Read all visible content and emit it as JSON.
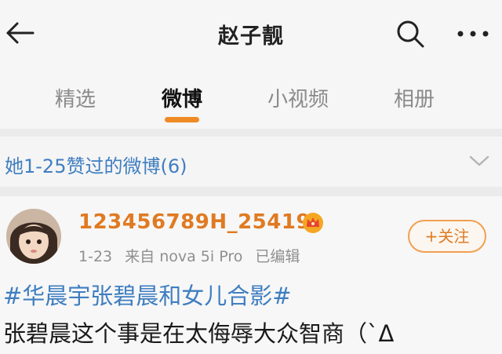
{
  "header": {
    "title": "赵子靓"
  },
  "tabs": [
    {
      "label": "精选",
      "active": false
    },
    {
      "label": "微博",
      "active": true
    },
    {
      "label": "小视频",
      "active": false
    },
    {
      "label": "相册",
      "active": false
    }
  ],
  "liked_summary": {
    "text": "她1-25赞过的微博(6)"
  },
  "post": {
    "username": "123456789H_25419",
    "date": "1-23",
    "source": "来自 nova 5i Pro",
    "edited": "已编辑",
    "follow_label": "+关注",
    "hashtag": "#华晨宇张碧晨和女儿合影#",
    "content": "张碧晨这个事是在太侮辱大众智商（`Δ"
  },
  "colors": {
    "accent_orange": "#f08a24",
    "link_blue": "#3f7ec0",
    "username_orange": "#e07a22"
  },
  "icons": [
    "back-arrow-icon",
    "search-icon",
    "more-dots-icon",
    "chevron-down-icon",
    "vip-crown-icon"
  ]
}
